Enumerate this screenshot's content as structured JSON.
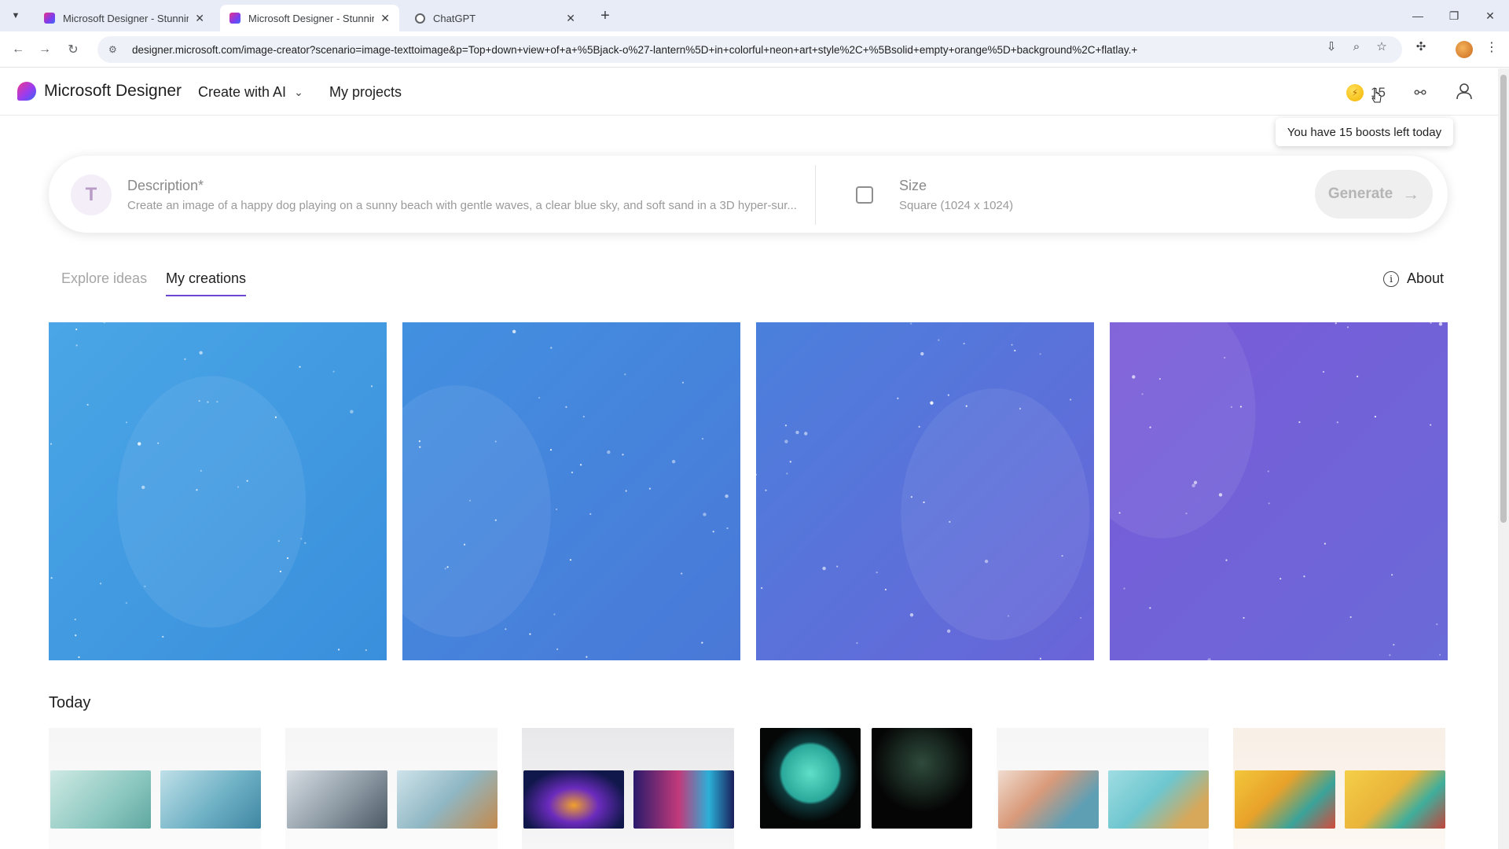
{
  "browser": {
    "tabs": [
      {
        "title": "Microsoft Designer - Stunning",
        "favicon": "designer-icon",
        "active": false
      },
      {
        "title": "Microsoft Designer - Stunning",
        "favicon": "designer-icon",
        "active": true
      },
      {
        "title": "ChatGPT",
        "favicon": "chatgpt-icon",
        "active": false
      }
    ],
    "url": "designer.microsoft.com/image-creator?scenario=image-texttoimage&p=Top+down+view+of+a+%5Bjack-o%27-lantern%5D+in+colorful+neon+art+style%2C+%5Bsolid+empty+orange%5D+background%2C+flatlay.+"
  },
  "header": {
    "brand": "Microsoft Designer",
    "create_menu": "Create with AI",
    "my_projects": "My projects",
    "boost_count": "15",
    "tooltip": "You have 15 boosts left today"
  },
  "prompt": {
    "description_label": "Description*",
    "description_placeholder": "Create an image of a happy dog playing on a sunny beach with gentle waves, a clear blue sky, and soft sand in a 3D hyper-sur...",
    "size_label": "Size",
    "size_value": "Square (1024 x 1024)",
    "generate_label": "Generate"
  },
  "tabs": {
    "explore": "Explore ideas",
    "mine": "My creations",
    "about": "About"
  },
  "tiles_colors": [
    [
      "#4aa6e6",
      "#3a8fdc"
    ],
    [
      "#4290e0",
      "#4a78d8"
    ],
    [
      "#4a80dc",
      "#6a64d8"
    ],
    [
      "#7a5ad8",
      "#6a6ad8"
    ]
  ],
  "today": {
    "title": "Today"
  },
  "colors": {
    "accent": "#6f47d6",
    "boost": "#f2b300"
  }
}
